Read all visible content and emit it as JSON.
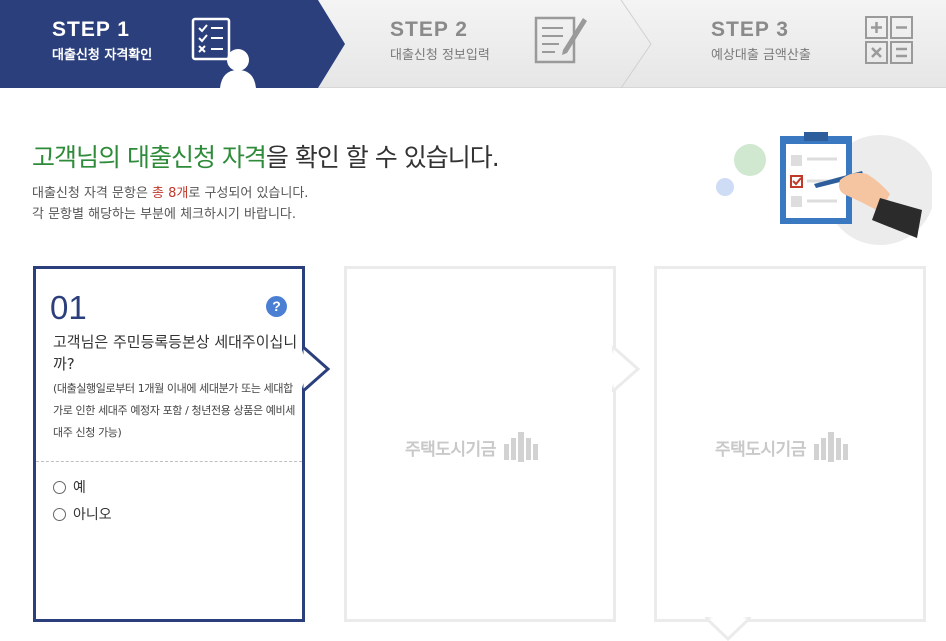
{
  "steps": [
    {
      "num": "STEP 1",
      "label": "대출신청 자격확인",
      "icon": "checklist-person-icon",
      "active": true
    },
    {
      "num": "STEP 2",
      "label": "대출신청 정보입력",
      "icon": "document-pen-icon",
      "active": false
    },
    {
      "num": "STEP 3",
      "label": "예상대출 금액산출",
      "icon": "calculator-icon",
      "active": false
    }
  ],
  "header": {
    "title_em": "고객님의 대출신청 자격",
    "title_rest": "을 확인 할 수 있습니다.",
    "desc_line1_a": "대출신청 자격 문항은 ",
    "desc_line1_em": "총 8개",
    "desc_line1_b": "로 구성되어 있습니다.",
    "desc_line2": "각 문항별 해당하는 부분에 체크하시기 바랍니다."
  },
  "question": {
    "number": "01",
    "help": "?",
    "text": "고객님은 주민등록등본상 세대주이십니까?",
    "note": "(대출실행일로부터 1개월 이내에 세대분가 또는 세대합가로 인한 세대주 예정자 포함 / 청년전용 상품은 예비세대주 신청 가능)",
    "options": [
      "예",
      "아니오"
    ]
  },
  "placeholder": {
    "watermark": "주택도시기금"
  },
  "colors": {
    "step_active": "#2b3f7c",
    "accent_green": "#2e8b3a",
    "accent_red": "#c0392b",
    "help_blue": "#4b7fd4"
  }
}
